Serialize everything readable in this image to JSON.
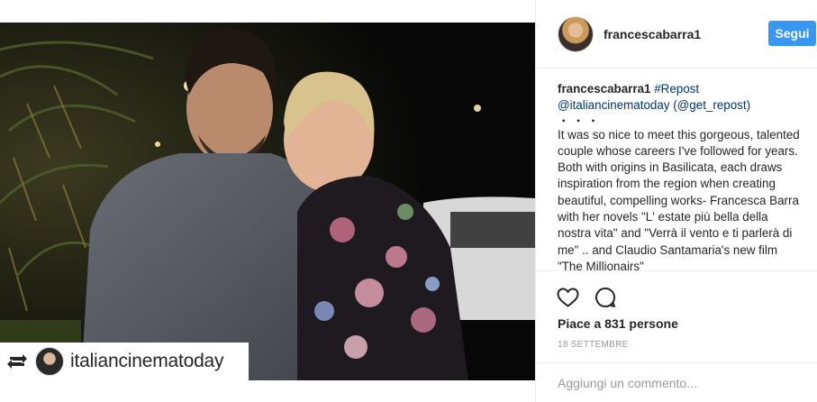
{
  "post": {
    "username": "francescabarra1",
    "follow_label": "Segui",
    "repost_user": "italiancinematoday",
    "caption": {
      "user": "francescabarra1",
      "tag": "#Repost",
      "mention": "@italiancinematoday",
      "via": "(@get_repost)",
      "dots": "・・・",
      "text": "It was so nice to meet this gorgeous, talented couple whose careers I've followed for years. Both with origins in Basilicata, each draws inspiration from the region when creating beautiful, compelling works- Francesca Barra with her novels \"L' estate più bella della nostra vita\" and \"Verrà il vento e ti parlerà di me\" .. and Claudio Santamaria's new film \"The Millionairs\""
    },
    "likes": "Piace a 831 persone",
    "date": "18 SETTEMBRE",
    "comment_placeholder": "Aggiungi un commento..."
  },
  "icons": {
    "like": "heart-icon",
    "comment": "comment-bubble-icon",
    "repost": "repost-icon"
  },
  "colors": {
    "follow_button": "#3897f0",
    "link": "#003569",
    "muted": "#999999"
  }
}
